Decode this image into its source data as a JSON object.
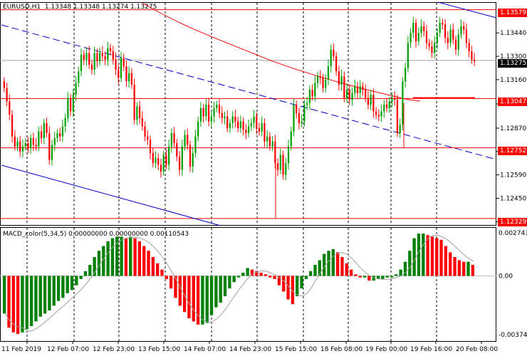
{
  "window": {
    "symbol_timeframe": "EURUSD,H1",
    "ohlc": "1.13348 1.13348 1.13274 1.13275"
  },
  "price_axis": {
    "ticks": [
      "1.13440",
      "1.13300",
      "1.13160",
      "1.13015",
      "1.12870",
      "1.12730",
      "1.12590",
      "1.12450",
      "1.12310"
    ],
    "current_price": "1.13275",
    "level_labels": [
      "1.13579",
      "1.13047",
      "1.12752",
      "1.12329"
    ]
  },
  "indicator": {
    "name": "MACD_color(5,34,5)",
    "values": "0.00000000 0.00000000 0.00110543",
    "axis_ticks": [
      "0.0027432",
      "0.00",
      "-0.003744"
    ]
  },
  "time_axis": {
    "labels": [
      "11 Feb 2019",
      "12 Feb 07:00",
      "12 Feb 23:00",
      "13 Feb 15:00",
      "14 Feb 07:00",
      "14 Feb 23:00",
      "15 Feb 15:00",
      "18 Feb 08:00",
      "19 Feb 00:00",
      "19 Feb 16:00",
      "20 Feb 08:00"
    ]
  },
  "colors": {
    "bull_candle": "#00a000",
    "bear_candle": "#ff0000",
    "ma_line": "#ff0000",
    "channel_dashed": "#0000cc",
    "channel_solid": "#0000cc",
    "level_line": "#ff0000",
    "macd_up": "#008000",
    "macd_down": "#ff0000",
    "signal_line": "#a0a0a0"
  },
  "chart_data": {
    "type": "candlestick",
    "price_ylim": [
      1.1229,
      1.1362
    ],
    "closes": [
      1.1311,
      1.1303,
      1.1295,
      1.1282,
      1.1276,
      1.1279,
      1.1273,
      1.1276,
      1.1278,
      1.1275,
      1.1281,
      1.1277,
      1.1276,
      1.1285,
      1.1281,
      1.129,
      1.1284,
      1.1268,
      1.1277,
      1.1281,
      1.1284,
      1.1282,
      1.1288,
      1.1293,
      1.1305,
      1.1297,
      1.1307,
      1.1314,
      1.1321,
      1.1331,
      1.1328,
      1.1332,
      1.1325,
      1.1322,
      1.1332,
      1.1327,
      1.1332,
      1.133,
      1.1328,
      1.1335,
      1.1333,
      1.1328,
      1.1322,
      1.1317,
      1.1329,
      1.1324,
      1.1315,
      1.132,
      1.1313,
      1.1292,
      1.13,
      1.1293,
      1.1288,
      1.1282,
      1.128,
      1.1272,
      1.1266,
      1.1269,
      1.1265,
      1.1261,
      1.1271,
      1.1265,
      1.1276,
      1.1284,
      1.1278,
      1.127,
      1.1262,
      1.1276,
      1.1283,
      1.1277,
      1.1264,
      1.1272,
      1.1282,
      1.1291,
      1.1299,
      1.1294,
      1.1301,
      1.1291,
      1.1294,
      1.1299,
      1.1301,
      1.1296,
      1.1293,
      1.1294,
      1.1287,
      1.129,
      1.1294,
      1.1291,
      1.1287,
      1.1291,
      1.1286,
      1.1284,
      1.1288,
      1.129,
      1.1294,
      1.1287,
      1.1285,
      1.129,
      1.1279,
      1.1282,
      1.1276,
      1.1279,
      1.1266,
      1.1262,
      1.1271,
      1.1259,
      1.1266,
      1.1276,
      1.1285,
      1.1301,
      1.1296,
      1.129,
      1.1291,
      1.1301,
      1.1302,
      1.131,
      1.1306,
      1.1314,
      1.1318,
      1.1317,
      1.1311,
      1.1316,
      1.1324,
      1.1334,
      1.133,
      1.1321,
      1.1313,
      1.1318,
      1.1305,
      1.131,
      1.1304,
      1.1308,
      1.1312,
      1.1308,
      1.1312,
      1.131,
      1.1305,
      1.1301,
      1.1307,
      1.1297,
      1.1295,
      1.1294,
      1.1297,
      1.1301,
      1.1299,
      1.1303,
      1.1305,
      1.1304,
      1.1284,
      1.1289,
      1.1315,
      1.1323,
      1.1338,
      1.1344,
      1.135,
      1.1339,
      1.1344,
      1.1348,
      1.1345,
      1.1338,
      1.1336,
      1.1332,
      1.1338,
      1.1344,
      1.135,
      1.1349,
      1.1341,
      1.1338,
      1.1346,
      1.134,
      1.1334,
      1.1343,
      1.1348,
      1.1346,
      1.1338,
      1.1333,
      1.1328,
      1.1327
    ],
    "macd_histogram": [
      -0.0024,
      -0.0033,
      -0.0036,
      -0.0037,
      -0.0036,
      -0.0034,
      -0.0032,
      -0.0029,
      -0.0026,
      -0.0024,
      -0.0022,
      -0.0019,
      -0.0016,
      -0.0014,
      -0.0011,
      -0.0009,
      -0.0006,
      -0.0002,
      0.0003,
      0.0007,
      0.0012,
      0.0016,
      0.0019,
      0.0022,
      0.0024,
      0.0025,
      0.0025,
      0.0024,
      0.0025,
      0.0024,
      0.0022,
      0.0019,
      0.0016,
      0.0012,
      0.0008,
      0.0004,
      -0.0002,
      -0.0008,
      -0.0014,
      -0.0019,
      -0.0023,
      -0.0027,
      -0.0029,
      -0.0031,
      -0.0031,
      -0.003,
      -0.0025,
      -0.002,
      -0.0017,
      -0.0013,
      -0.0008,
      -0.0004,
      -0.0001,
      0.0002,
      0.0005,
      0.0004,
      0.0003,
      0.0002,
      0.0001,
      -0.0001,
      -0.0002,
      -0.0006,
      -0.001,
      -0.0015,
      -0.0018,
      -0.0013,
      -0.0008,
      -0.0002,
      0.0003,
      0.0007,
      0.001,
      0.0014,
      0.0016,
      0.0017,
      0.0015,
      0.0012,
      0.0008,
      0.0004,
      0.0001,
      -0.0001,
      -0.0001,
      -0.0003,
      -0.0003,
      -0.0002,
      -0.0002,
      -0.0001,
      -0.0001,
      0.0001,
      0.0004,
      0.0009,
      0.0016,
      0.0024,
      0.0027,
      0.0027,
      0.0026,
      0.0025,
      0.0024,
      0.0023,
      0.0019,
      0.0015,
      0.0012,
      0.001,
      0.0009,
      0.0009,
      0.0007
    ],
    "macd_ylim": [
      -0.003744,
      0.0027432
    ]
  }
}
